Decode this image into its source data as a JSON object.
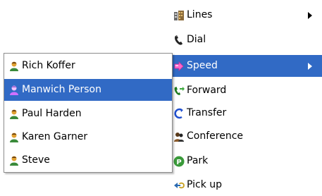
{
  "colors": {
    "selection": "#316ac5"
  },
  "main_menu": {
    "items": [
      {
        "label": "Lines",
        "icon": "lines-icon",
        "submenu": true
      },
      {
        "label": "Dial",
        "icon": "phone-icon"
      },
      {
        "label": "Speed",
        "icon": "speed-icon",
        "submenu": true,
        "selected": true
      },
      {
        "label": "Forward",
        "icon": "forward-icon"
      },
      {
        "label": "Transfer",
        "icon": "transfer-icon"
      },
      {
        "label": "Conference",
        "icon": "conference-icon"
      },
      {
        "label": "Park",
        "icon": "park-icon",
        "icon_text": "P"
      },
      {
        "label": "Pick up",
        "icon": "pickup-icon"
      }
    ]
  },
  "speed_submenu": {
    "items": [
      {
        "label": "Rich Koffer",
        "icon": "contact-icon"
      },
      {
        "label": "Manwich Person",
        "icon": "contact-icon",
        "selected": true
      },
      {
        "label": "Paul Harden",
        "icon": "contact-icon"
      },
      {
        "label": "Karen Garner",
        "icon": "contact-icon"
      },
      {
        "label": "Steve",
        "icon": "contact-icon"
      }
    ]
  }
}
